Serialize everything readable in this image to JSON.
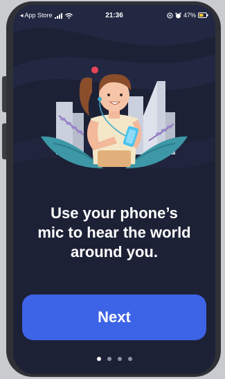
{
  "status_bar": {
    "back_label": "◂ App Store",
    "time": "21:36",
    "battery_percent": "47%"
  },
  "onboarding": {
    "headline_line1": "Use your phone’s",
    "headline_line2": "mic to hear the world",
    "headline_line3": "around you.",
    "next_label": "Next",
    "page_count": 4,
    "active_page": 1
  },
  "colors": {
    "background": "#1d2136",
    "button": "#3d63e6",
    "text": "#ffffff"
  }
}
